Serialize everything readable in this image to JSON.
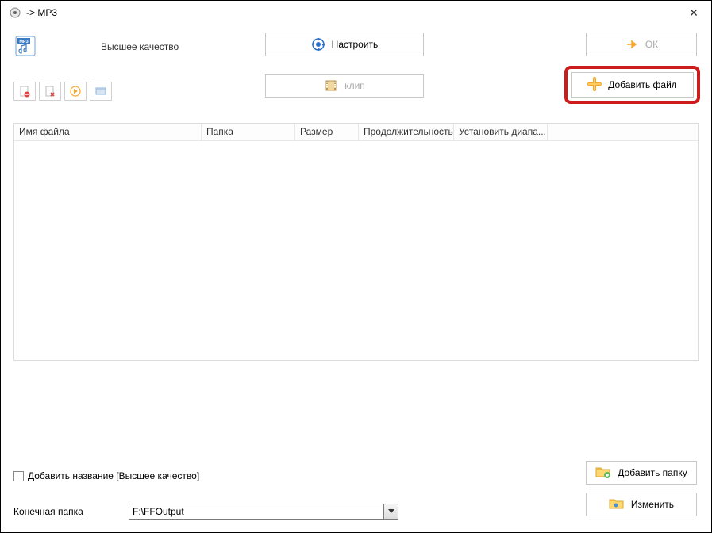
{
  "title": "-> MP3",
  "quality": "Высшее качество",
  "buttons": {
    "configure": "Настроить",
    "ok": "ОК",
    "clip": "клип",
    "addfile": "Добавить файл",
    "addfolder": "Добавить папку",
    "change": "Изменить"
  },
  "columns": {
    "filename": "Имя файла",
    "folder": "Папка",
    "size": "Размер",
    "duration": "Продолжительность",
    "range": "Установить диапа..."
  },
  "addname_label": "Добавить название [Высшее качество]",
  "dest_label": "Конечная папка",
  "dest_value": "F:\\FFOutput"
}
